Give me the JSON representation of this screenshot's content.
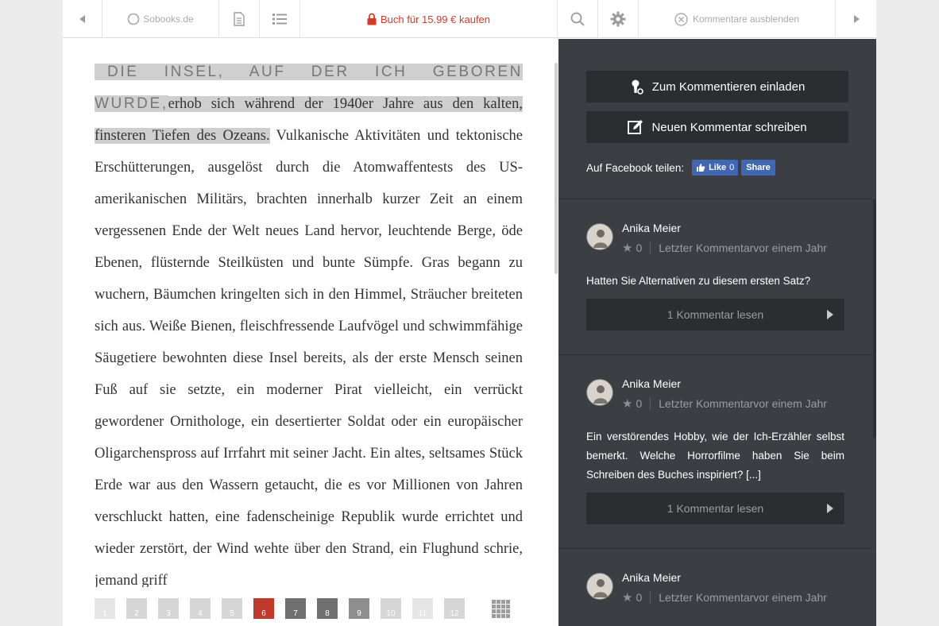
{
  "toolbar": {
    "site": "Sobooks.de",
    "buy": "Buch für 15.99 € kaufen",
    "hide_comments": "Kommentare ausblenden"
  },
  "text": {
    "lead": "Die Insel, auf der ich geboren wurde,",
    "highlight": "erhob sich während der 1940er Jahre aus den kalten, finsteren Tiefen des Ozeans.",
    "body": " Vulkanische Aktivitäten und tektonische Erschütterungen, ausgelöst durch die Atomwaffentests des US-amerikanischen Militärs, brachten innerhalb kurzer Zeit an einem vergessenen Ende der Welt neues Land hervor, leuchtende Berge, öde Ebenen, flüsternde Steilküsten und bunte Sümpfe. Gras begann zu wuchern, Bäumchen kringelten sich in den Himmel, Sträucher breiteten sich aus. Weiße Bienen, fleischfressende Laufvögel und schwimmfähige Säugetiere bewohnten diese Insel bereits, als der erste Mensch seinen Fuß auf sie setzte, ein moderner Pirat vielleicht, ein verrückt gewordener Ornithologe, ein desertierter Soldat oder ein europäischer Oligarchenspross auf Irrfahrt mit seiner Jacht. Ein altes, seltsames Stück Erde war aus den Wassern getaucht, die es vor Millionen von Jahren verschluckt hatten, eine fadenscheinige Republik wurde errichtet und wieder zerstört, der Wind wehte über den Strand, ein Flughund schrie, jemand griff"
  },
  "pager": {
    "pages": [
      "1",
      "2",
      "3",
      "4",
      "5",
      "6",
      "7",
      "8",
      "9",
      "10",
      "11",
      "12"
    ],
    "active_page": 6
  },
  "comments_panel": {
    "invite_button": "Zum Kommentieren einladen",
    "new_comment_button": "Neuen Kommentar schreiben",
    "facebook_label": "Auf Facebook teilen:",
    "fb_like": "Like",
    "fb_like_count": "0",
    "fb_share": "Share",
    "comments": [
      {
        "author": "Anika Meier",
        "stars": "0",
        "meta": "Letzter Kommentarvor einem Jahr",
        "text": "Hatten Sie Alternativen zu diesem ersten Satz?",
        "read": "1 Kommentar lesen"
      },
      {
        "author": "Anika Meier",
        "stars": "0",
        "meta": "Letzter Kommentarvor einem Jahr",
        "text": "Ein verstörendes Hobby, wie der Ich-Erzähler selbst bemerkt. Welche Horrorfilme haben Sie beim Schreiben des Buches inspiriert? [...]",
        "read": "1 Kommentar lesen"
      },
      {
        "author": "Anika Meier",
        "stars": "0",
        "meta": "Letzter Kommentarvor einem Jahr"
      }
    ]
  },
  "colors": {
    "accent_red": "#c0392b",
    "panel_bg": "#3b3e42",
    "button_bg": "#2b2d30",
    "facebook_blue": "#4267b2"
  }
}
